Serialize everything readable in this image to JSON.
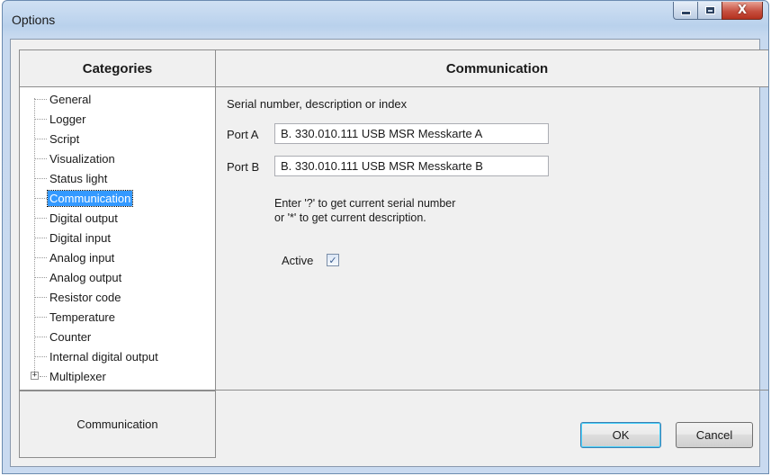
{
  "window": {
    "title": "Options",
    "controls": {
      "minimize_icon": "minimize-icon",
      "maximize_icon": "maximize-icon",
      "close_icon": "close-icon",
      "close_glyph": "X"
    }
  },
  "categories": {
    "header": "Categories",
    "items": [
      {
        "label": "General"
      },
      {
        "label": "Logger"
      },
      {
        "label": "Script"
      },
      {
        "label": "Visualization"
      },
      {
        "label": "Status light"
      },
      {
        "label": "Communication",
        "selected": true
      },
      {
        "label": "Digital output"
      },
      {
        "label": "Digital input"
      },
      {
        "label": "Analog input"
      },
      {
        "label": "Analog output"
      },
      {
        "label": "Resistor code"
      },
      {
        "label": "Temperature"
      },
      {
        "label": "Counter"
      },
      {
        "label": "Internal digital output"
      },
      {
        "label": "Multiplexer",
        "expander": "+"
      }
    ],
    "status_text": "Communication"
  },
  "communication": {
    "header": "Communication",
    "section_label": "Serial number, description or index",
    "port_a": {
      "label": "Port A",
      "value": "B. 330.010.111 USB MSR Messkarte A"
    },
    "port_b": {
      "label": "Port B",
      "value": "B. 330.010.111 USB MSR Messkarte B"
    },
    "hint_line1": "Enter '?' to get current serial number",
    "hint_line2": "or '*' to get current description.",
    "active_label": "Active",
    "active_checked": true
  },
  "buttons": {
    "ok": "OK",
    "cancel": "Cancel"
  },
  "colors": {
    "selection": "#3399ff",
    "title_bar": "#b9d1ec",
    "close_button": "#c75040"
  }
}
